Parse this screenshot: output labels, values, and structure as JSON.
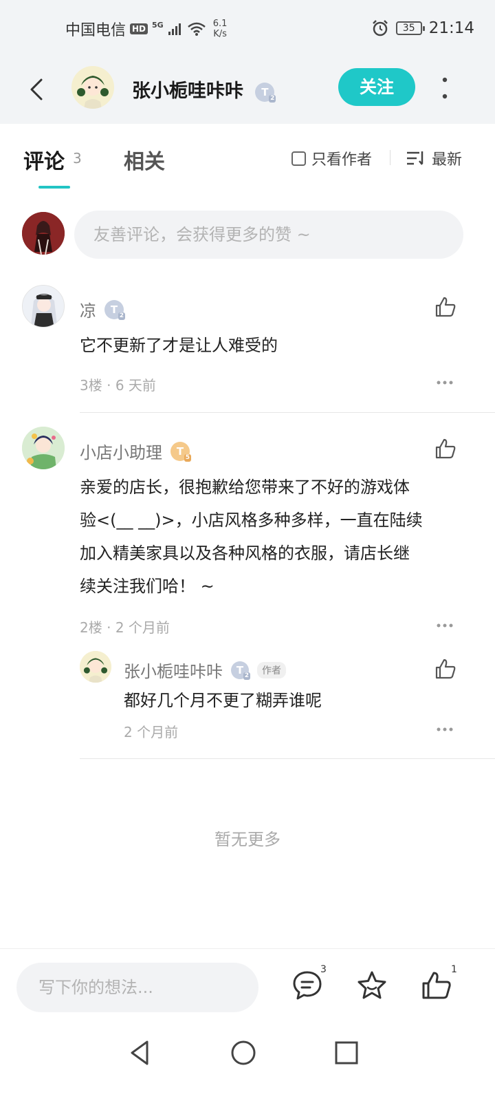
{
  "status_bar": {
    "carrier": "中国电信",
    "hd": "HD",
    "network": "5G",
    "speed_value": "6.1",
    "speed_unit": "K/s",
    "battery": "35",
    "time": "21:14"
  },
  "header": {
    "title": "张小栀哇咔咔",
    "level": "T",
    "level_sub": "2",
    "follow_label": "关注"
  },
  "tabs": {
    "comments_label": "评论",
    "comments_count": "3",
    "related_label": "相关",
    "author_only_label": "只看作者",
    "sort_label": "最新"
  },
  "compose": {
    "placeholder": "友善评论，会获得更多的赞 ~"
  },
  "comments": [
    {
      "user": "凉",
      "level": "T",
      "level_sub": "2",
      "text": "它不更新了才是让人难受的",
      "floor": "3楼",
      "time": "6 天前"
    },
    {
      "user": "小店小助理",
      "level": "T",
      "level_sub": "5",
      "text_lines": [
        "亲爱的店长，很抱歉给您带来了不好的游戏体",
        "验<(__ __)>，小店风格多种多样，一直在陆续",
        "加入精美家具以及各种风格的衣服，请店长继",
        "续关注我们哈！ ~"
      ],
      "floor": "2楼",
      "time": "2 个月前",
      "reply": {
        "user": "张小栀哇咔咔",
        "level": "T",
        "level_sub": "2",
        "author_tag": "作者",
        "text": "都好几个月不更了糊弄谁呢",
        "time": "2 个月前"
      }
    }
  ],
  "meta_separator": "·",
  "no_more": "暂无更多",
  "bottom_bar": {
    "placeholder": "写下你的想法...",
    "comment_count": "3",
    "like_count": "1"
  },
  "colors": {
    "accent": "#1fc8c8",
    "header_bg": "#f2f4f6"
  }
}
